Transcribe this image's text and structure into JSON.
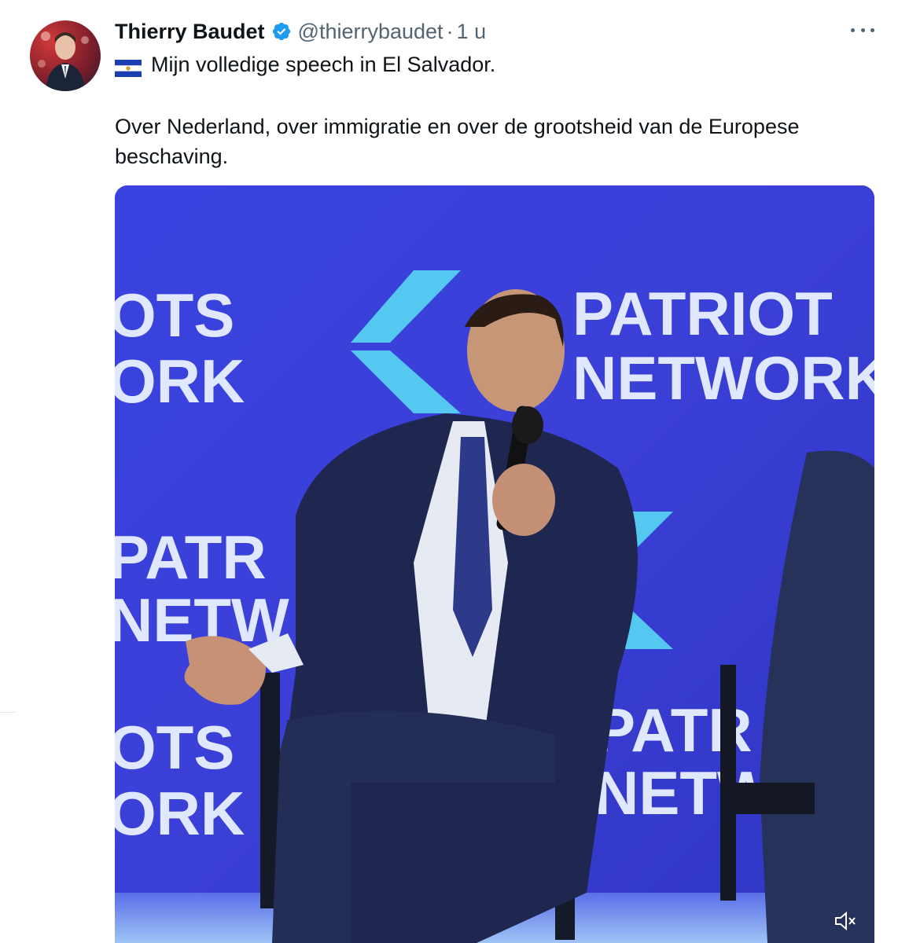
{
  "tweet": {
    "author_name": "Thierry Baudet",
    "handle": "@thierrybaudet",
    "separator": "·",
    "time": "1 u",
    "line1": "Mijn volledige speech in El Salvador.",
    "line2": "Over Nederland, over immigratie en over de grootsheid van de Europese beschaving.",
    "icons": {
      "verified": "verified-badge-icon",
      "more": "more-icon",
      "flag": "el-salvador-flag-icon",
      "mute": "speaker-muted-icon"
    }
  },
  "media": {
    "backdrop_text": {
      "left_top_1": "OTS",
      "left_top_2": "ORK",
      "center_1": "PATRIOT",
      "center_2": "NETWORK",
      "left_mid_1": "PATR",
      "left_mid_2": "NETW",
      "left_bot_1": "OTS",
      "left_bot_2": "ORK",
      "right_bot_1": "PATR",
      "right_bot_2": "NETW"
    }
  },
  "colors": {
    "accent_blue": "#1d9bf0",
    "backdrop_blue": "#3a3fd6",
    "logo_cyan": "#54c8f0"
  }
}
